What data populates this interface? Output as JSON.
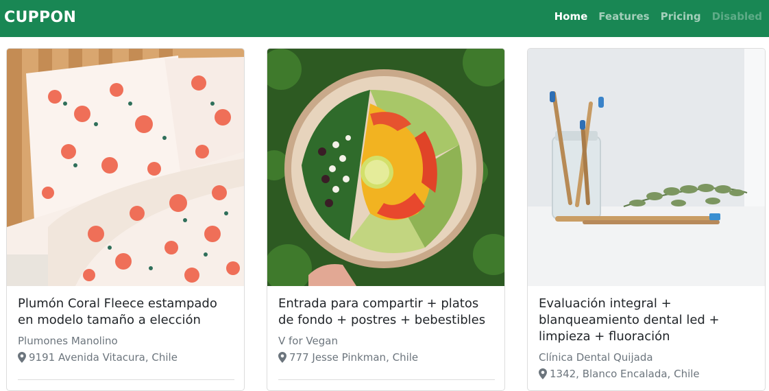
{
  "nav": {
    "brand": "CUPPON",
    "links": [
      {
        "label": "Home",
        "state": "active"
      },
      {
        "label": "Features",
        "state": "normal"
      },
      {
        "label": "Pricing",
        "state": "normal"
      },
      {
        "label": "Disabled",
        "state": "disabled"
      }
    ]
  },
  "colors": {
    "navbar": "#198754",
    "text_muted": "#6c757d",
    "title": "#212529"
  },
  "cards": [
    {
      "title": "Plumón Coral Fleece estampado en modelo tamaño a elección",
      "merchant": "Plumones Manolino",
      "address": "9191 Avenida Vitacura, Chile",
      "icon": "map-pin-icon"
    },
    {
      "title": "Entrada para compartir + platos de fondo + postres + bebestibles",
      "merchant": "V for Vegan",
      "address": "777 Jesse Pinkman, Chile",
      "icon": "map-pin-icon"
    },
    {
      "title": "Evaluación integral + blanqueamiento dental led + limpieza + fluoración",
      "merchant": "Clínica Dental Quijada",
      "address": "1342, Blanco Encalada, Chile",
      "icon": "map-pin-icon"
    }
  ]
}
